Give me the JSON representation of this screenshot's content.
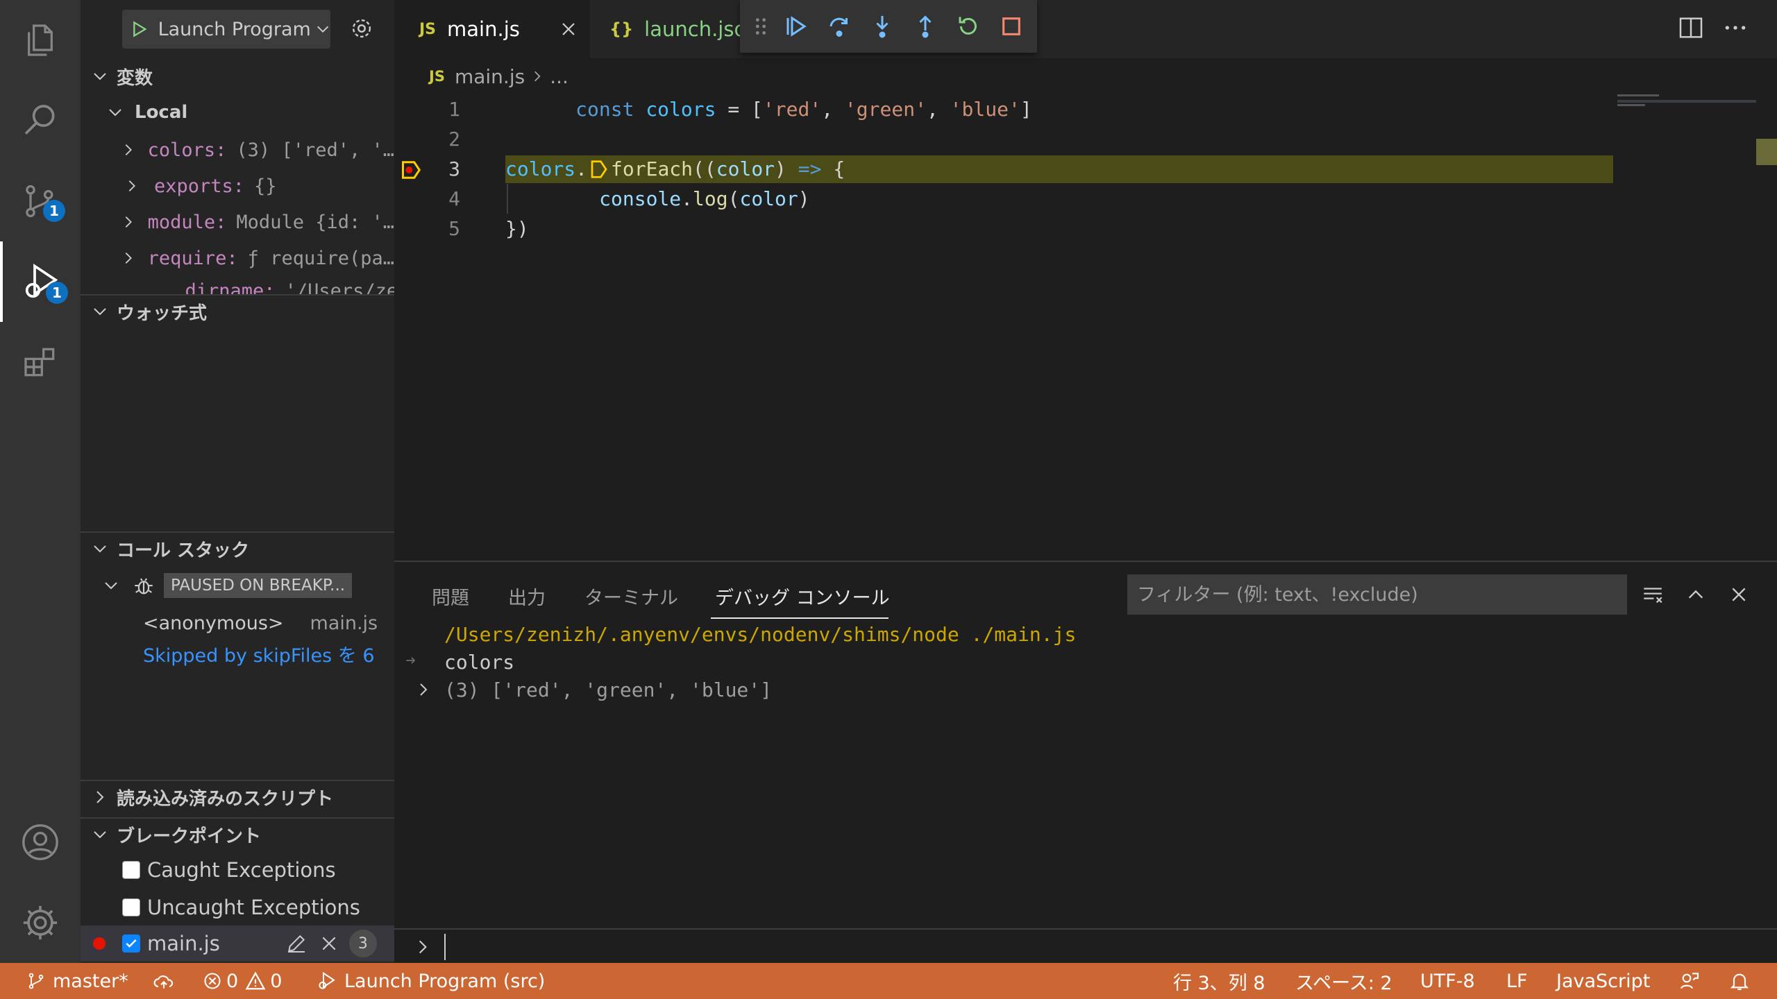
{
  "sidebar": {
    "launch_config": "Launch Program",
    "variables": {
      "title": "変数",
      "scope": "Local",
      "items": [
        {
          "name": "colors:",
          "value": "(3) ['red', '…"
        },
        {
          "name": "exports:",
          "value": "{}"
        },
        {
          "name": "module:",
          "value": "Module {id: '…"
        },
        {
          "name": "require:",
          "value": "ƒ require(pa…"
        },
        {
          "name": "__dirname:",
          "value": "'/Users/ze…"
        }
      ]
    },
    "watch": {
      "title": "ウォッチ式"
    },
    "callstack": {
      "title": "コール スタック",
      "paused_label": "PAUSED ON BREAKP...",
      "frame_name": "<anonymous>",
      "frame_file": "main.js",
      "skipped": "Skipped by skipFiles を 6"
    },
    "loaded_scripts": {
      "title": "読み込み済みのスクリプト"
    },
    "breakpoints": {
      "title": "ブレークポイント",
      "items": [
        {
          "label": "Caught Exceptions",
          "checked": false
        },
        {
          "label": "Uncaught Exceptions",
          "checked": false
        },
        {
          "label": "main.js",
          "checked": true,
          "line": "3"
        }
      ]
    }
  },
  "activity": {
    "scm_badge": "1",
    "debug_badge": "1"
  },
  "editor": {
    "tabs": [
      {
        "icon": "JS",
        "label": "main.js"
      },
      {
        "icon": "{}",
        "label": "launch.json"
      }
    ],
    "breadcrumb": {
      "icon": "JS",
      "file": "main.js",
      "rest": "..."
    },
    "lines": [
      {
        "n": "1"
      },
      {
        "n": "2"
      },
      {
        "n": "3"
      },
      {
        "n": "4"
      },
      {
        "n": "5"
      }
    ],
    "code": {
      "l1": {
        "kw": "const",
        "var": "colors",
        "eq": " = [",
        "s1": "'red'",
        "c1": ", ",
        "s2": "'green'",
        "c2": ", ",
        "s3": "'blue'",
        "end": "]"
      },
      "l3": {
        "obj": "colors",
        "dot": ".",
        "fn": "forEach",
        "p1": "((",
        "param": "color",
        "p2": ") ",
        "arrow": "=>",
        "brace": " {"
      },
      "l4": {
        "obj": "console",
        "dot": ".",
        "fn": "log",
        "p1": "(",
        "param": "color",
        "p2": ")"
      },
      "l5": {
        "text": "})"
      }
    }
  },
  "panel": {
    "tabs": [
      "問題",
      "出力",
      "ターミナル",
      "デバッグ コンソール"
    ],
    "filter_placeholder": "フィルター (例: text、!exclude)",
    "console": {
      "cmd": "/Users/zenizh/.anyenv/envs/nodenv/shims/node ./main.js",
      "out1": "colors",
      "out2": "(3) ['red', 'green', 'blue']"
    }
  },
  "statusbar": {
    "branch": "master*",
    "errors": "0",
    "warnings": "0",
    "launch": "Launch Program (src)",
    "position": "行 3、列 8",
    "spaces": "スペース: 2",
    "encoding": "UTF-8",
    "eol": "LF",
    "language": "JavaScript"
  },
  "colors": {
    "status_bar": "#cc6633",
    "highlight_line": "#4b4b18",
    "accent": "#75beff"
  }
}
